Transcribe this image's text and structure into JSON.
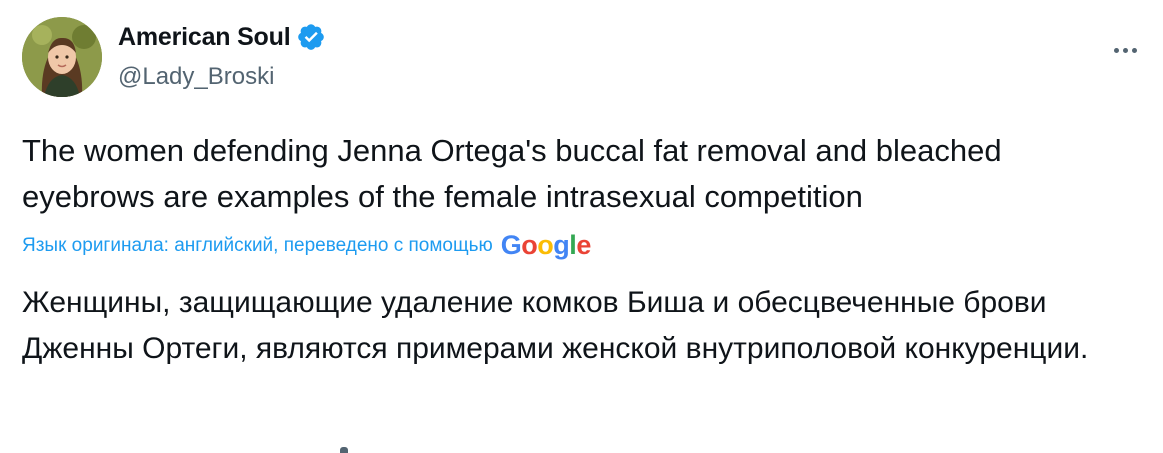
{
  "author": {
    "display_name": "American Soul",
    "handle": "@Lady_Broski",
    "verified": true,
    "verified_color": "#1d9bf0"
  },
  "tweet": {
    "original_text": "The women defending Jenna Ortega's buccal fat removal and bleached eyebrows are examples of the female intrasexual competition",
    "translation_note": "Язык оригинала: английский, переведено с помощью",
    "translation_provider": "Google",
    "translated_text": "Женщины, защищающие удаление комков Биша и обесцвеченные брови Дженны Ортеги, являются примерами женской внутриполовой конкуренции."
  },
  "icons": {
    "avatar": "avatar-image",
    "verified": "verified-badge-icon",
    "more": "more-options-icon"
  },
  "colors": {
    "text": "#0f1419",
    "secondary": "#536471",
    "link": "#1d9bf0"
  }
}
